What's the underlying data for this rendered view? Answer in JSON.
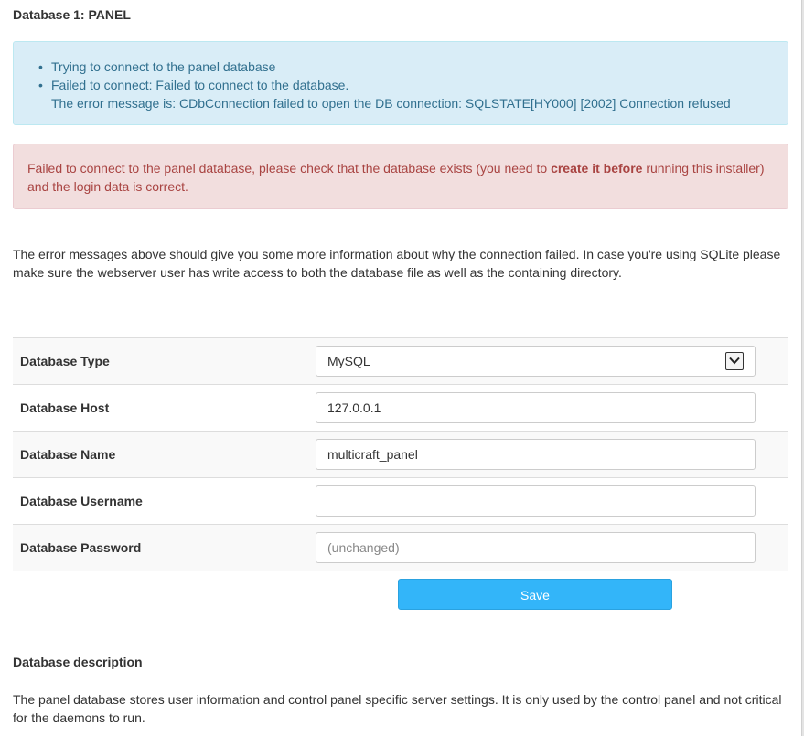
{
  "page": {
    "title": "Database 1: PANEL"
  },
  "info": {
    "items": [
      "Trying to connect to the panel database",
      "Failed to connect: Failed to connect to the database."
    ],
    "error_detail": "The error message is: CDbConnection failed to open the DB connection: SQLSTATE[HY000] [2002] Connection refused",
    "bullet": "•"
  },
  "danger": {
    "text_before": "Failed to connect to the panel database, please check that the database exists (you need to ",
    "text_bold": "create it before",
    "text_after": " running this installer) and the login data is correct."
  },
  "help": {
    "text": "The error messages above should give you some more information about why the connection failed. In case you're using SQLite please make sure the webserver user has write access to both the database file as well as the containing directory."
  },
  "form": {
    "db_type": {
      "label": "Database Type",
      "value": "MySQL"
    },
    "db_host": {
      "label": "Database Host",
      "value": "127.0.0.1",
      "placeholder": ""
    },
    "db_name": {
      "label": "Database Name",
      "value": "multicraft_panel",
      "placeholder": ""
    },
    "db_user": {
      "label": "Database Username",
      "value": "",
      "placeholder": ""
    },
    "db_pass": {
      "label": "Database Password",
      "value": "",
      "placeholder": "(unchanged)"
    },
    "save_label": "Save"
  },
  "description": {
    "title": "Database description",
    "text": "The panel database stores user information and control panel specific server settings. It is only used by the control panel and not critical for the daemons to run."
  },
  "colors": {
    "info_bg": "#d9edf7",
    "info_text": "#31708f",
    "danger_bg": "#f2dede",
    "danger_text": "#a94442",
    "button_bg": "#33b5f9"
  },
  "icons": {
    "select_arrow": "chevron-down-icon"
  }
}
